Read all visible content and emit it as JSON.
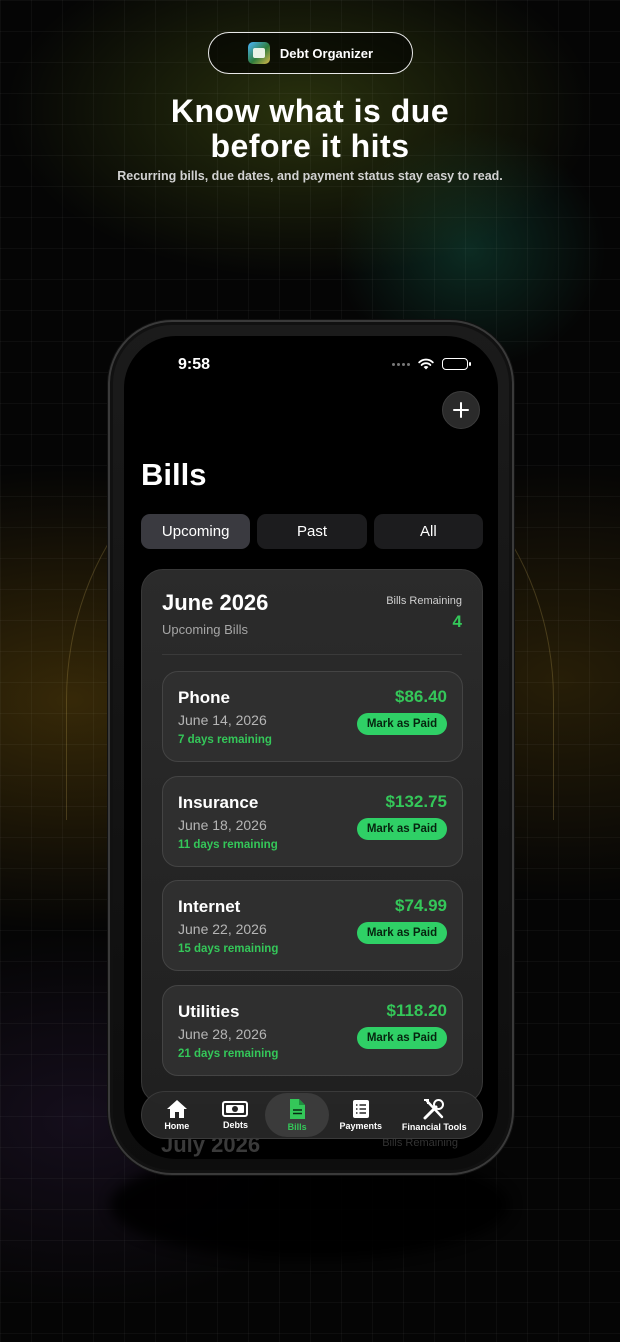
{
  "promo": {
    "app_name": "Debt Organizer",
    "headline_line1": "Know what is due",
    "headline_line2": "before it hits",
    "subheadline": "Recurring bills, due dates, and payment status stay easy to read."
  },
  "status_bar": {
    "time": "9:58"
  },
  "screen": {
    "title": "Bills",
    "add_icon": "plus-icon",
    "segments": [
      {
        "label": "Upcoming",
        "selected": true
      },
      {
        "label": "Past",
        "selected": false
      },
      {
        "label": "All",
        "selected": false
      }
    ]
  },
  "month_group": {
    "title": "June 2026",
    "subtitle": "Upcoming Bills",
    "remaining_label": "Bills Remaining",
    "remaining_count": "4",
    "bills": [
      {
        "name": "Phone",
        "date": "June 14, 2026",
        "days_remaining": "7 days remaining",
        "amount": "$86.40",
        "action": "Mark as Paid"
      },
      {
        "name": "Insurance",
        "date": "June 18, 2026",
        "days_remaining": "11 days remaining",
        "amount": "$132.75",
        "action": "Mark as Paid"
      },
      {
        "name": "Internet",
        "date": "June 22, 2026",
        "days_remaining": "15 days remaining",
        "amount": "$74.99",
        "action": "Mark as Paid"
      },
      {
        "name": "Utilities",
        "date": "June 28, 2026",
        "days_remaining": "21 days remaining",
        "amount": "$118.20",
        "action": "Mark as Paid"
      }
    ]
  },
  "next_group": {
    "title": "July 2026",
    "remaining_label": "Bills Remaining"
  },
  "tab_bar": {
    "items": [
      {
        "label": "Home",
        "icon": "house-icon",
        "selected": false
      },
      {
        "label": "Debts",
        "icon": "banknote-icon",
        "selected": false
      },
      {
        "label": "Bills",
        "icon": "document-icon",
        "selected": true
      },
      {
        "label": "Payments",
        "icon": "list-icon",
        "selected": false
      },
      {
        "label": "Financial Tools",
        "icon": "tools-icon",
        "selected": false
      }
    ]
  },
  "colors": {
    "accent_green": "#34c759",
    "button_green": "#2fd066",
    "card_background": "#2f2f2f",
    "screen_background": "#000000"
  }
}
